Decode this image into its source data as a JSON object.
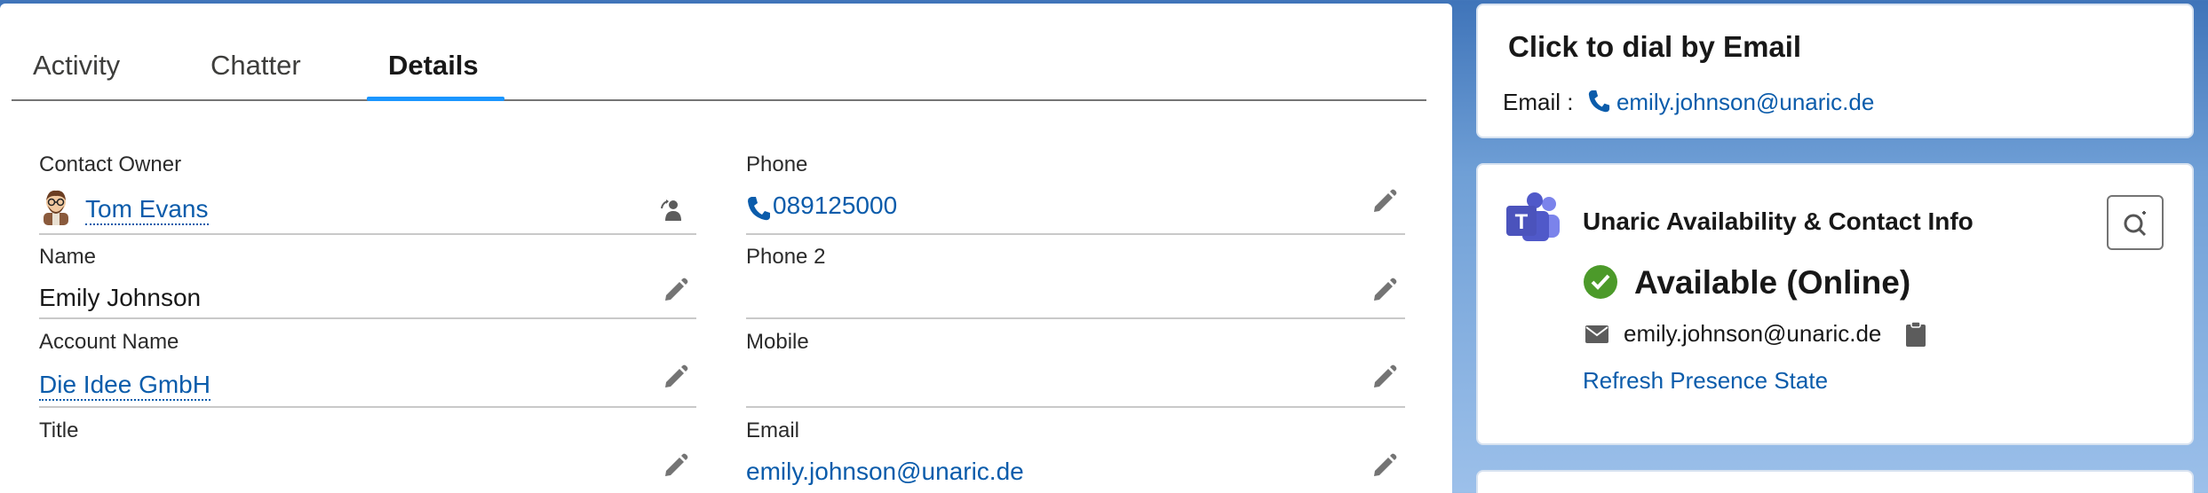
{
  "tabs": [
    {
      "label": "Activity"
    },
    {
      "label": "Chatter"
    },
    {
      "label": "Details"
    }
  ],
  "fields": {
    "contact_owner": {
      "label": "Contact Owner",
      "value": "Tom Evans"
    },
    "phone": {
      "label": "Phone",
      "value": "089125000"
    },
    "name": {
      "label": "Name",
      "value": "Emily Johnson"
    },
    "phone2": {
      "label": "Phone 2",
      "value": ""
    },
    "account_name": {
      "label": "Account Name",
      "value": "Die Idee GmbH"
    },
    "mobile": {
      "label": "Mobile",
      "value": ""
    },
    "title": {
      "label": "Title",
      "value": ""
    },
    "email": {
      "label": "Email",
      "value": "emily.johnson@unaric.de"
    }
  },
  "dial_card": {
    "title": "Click to dial by Email",
    "email_label": "Email :",
    "email_value": "emily.johnson@unaric.de"
  },
  "presence_card": {
    "title": "Unaric Availability & Contact Info",
    "status": "Available (Online)",
    "email": "emily.johnson@unaric.de",
    "refresh_link": "Refresh Presence State"
  },
  "colors": {
    "link": "#0b5cab",
    "tab_active_bar": "#1b96ff",
    "available_green": "#4c9a2a",
    "teams_purple": "#5059c9"
  },
  "icons": [
    "phone-icon",
    "pencil-icon",
    "change-owner-icon",
    "avatar",
    "teams-logo-icon",
    "check-circle-icon",
    "mail-icon",
    "clipboard-icon",
    "search-person-icon"
  ]
}
